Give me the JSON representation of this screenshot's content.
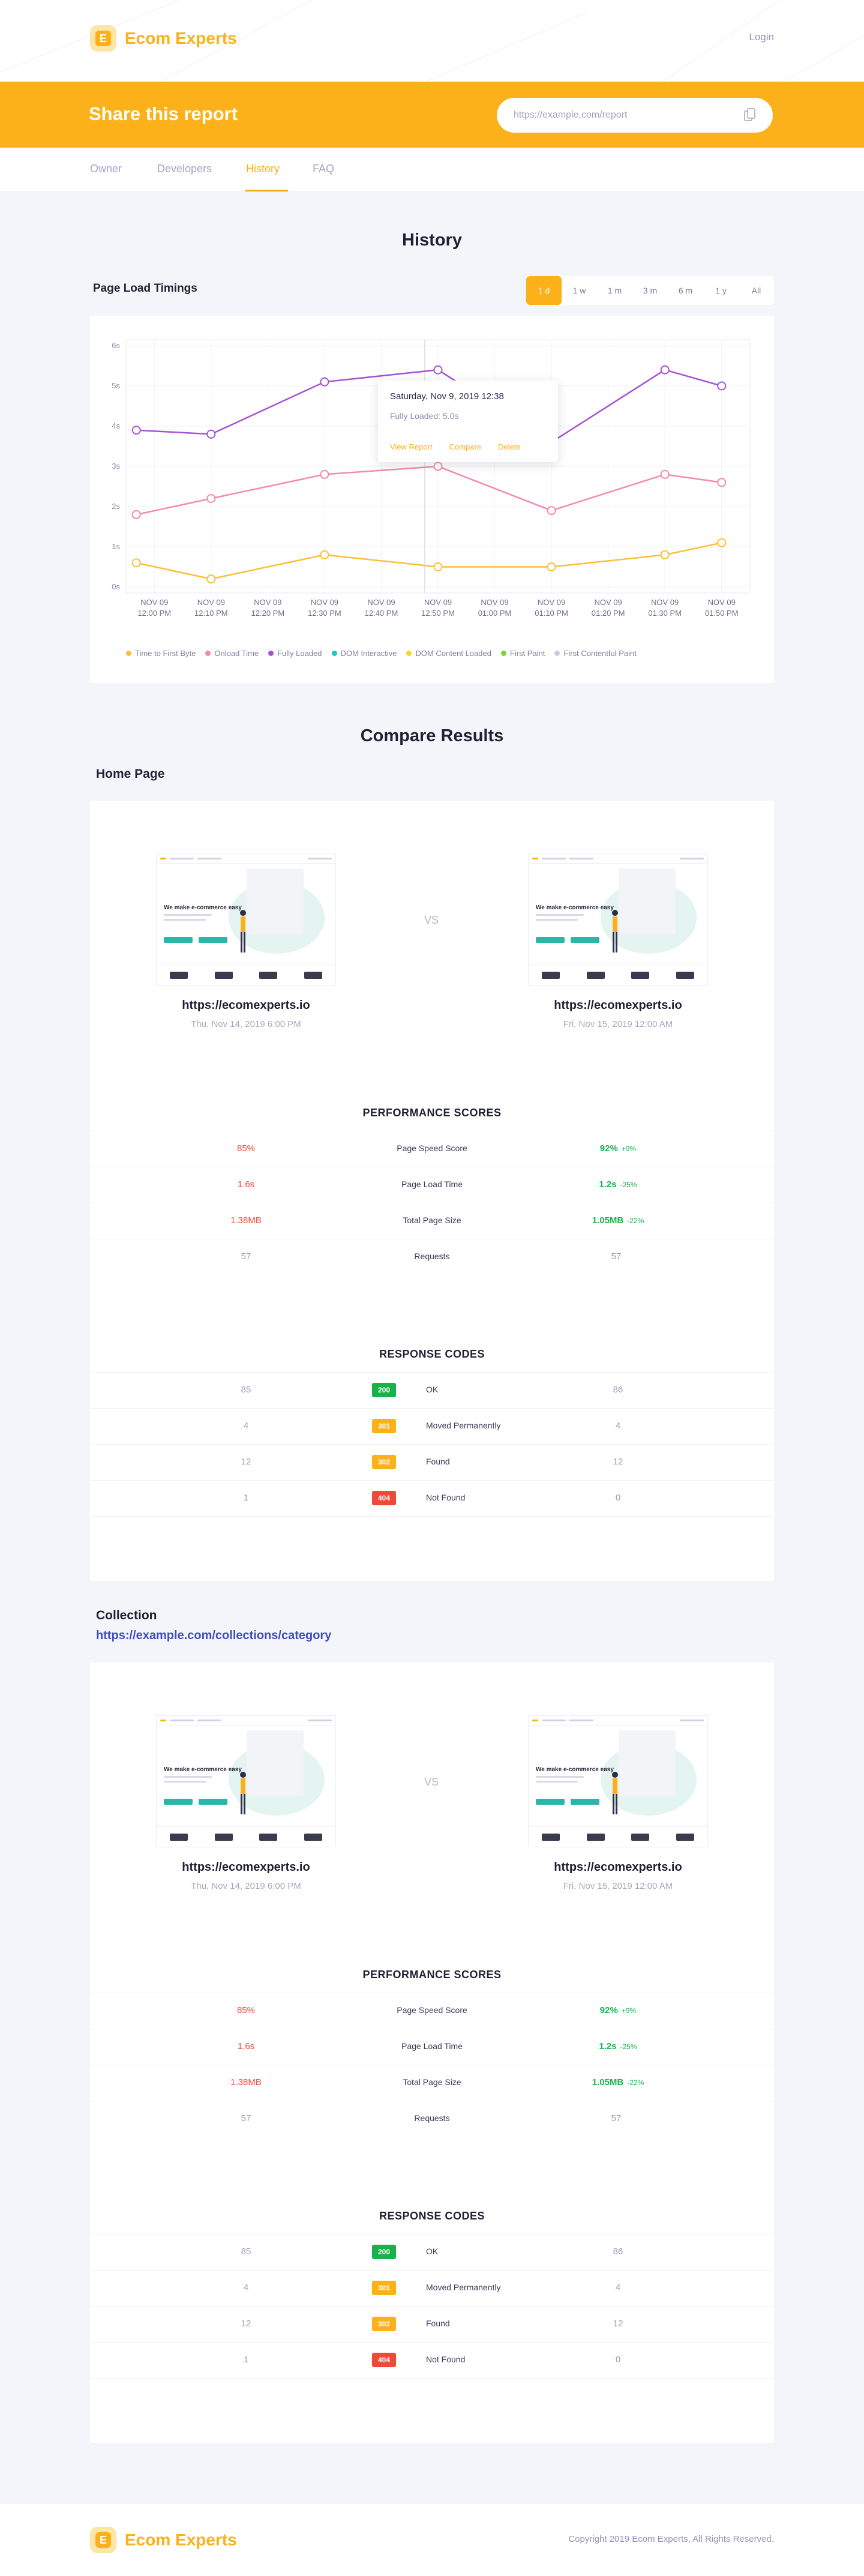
{
  "brand": {
    "name": "Ecom Experts",
    "accent": "#fcb11a"
  },
  "header": {
    "login_label": "Login"
  },
  "share": {
    "title": "Share this report",
    "url_value": "https://example.com/report"
  },
  "tabs": [
    {
      "label": "Owner"
    },
    {
      "label": "Developers"
    },
    {
      "label": "History"
    },
    {
      "label": "FAQ"
    }
  ],
  "active_tab": "History",
  "history": {
    "title": "History",
    "chart_label": "Page Load Timings",
    "ranges": [
      "1 d",
      "1 w",
      "1 m",
      "3 m",
      "6 m",
      "1 y",
      "All"
    ],
    "active_range": "1 d",
    "tooltip": {
      "title": "Saturday, Nov 9, 2019 12:38",
      "value": "Fully Loaded: 5.0s",
      "actions": [
        "View Report",
        "Compare",
        "Delete"
      ]
    }
  },
  "chart_data": {
    "type": "line",
    "categories": [
      "NOV 09 12:00 PM",
      "NOV 09 12:10 PM",
      "NOV 09 12:20 PM",
      "NOV 09 12:30 PM",
      "NOV 09 12:40 PM",
      "NOV 09 12:50 PM",
      "NOV 09 01:00 PM",
      "NOV 09 01:10 PM",
      "NOV 09 01:20 PM",
      "NOV 09 01:30 PM",
      "NOV 09 01:50 PM"
    ],
    "ylim": [
      0,
      6
    ],
    "yticks": [
      "0s",
      "1s",
      "2s",
      "3s",
      "4s",
      "5s",
      "6s"
    ],
    "series": [
      {
        "name": "Time to First Byte",
        "color": "#fcc032",
        "x_index": [
          0,
          1,
          3,
          5,
          7,
          9,
          10
        ],
        "values": [
          0.6,
          0.2,
          0.8,
          0.5,
          0.5,
          0.8,
          1.1
        ]
      },
      {
        "name": "Onload Time",
        "color": "#f58aa8",
        "x_index": [
          0,
          1,
          3,
          5,
          7,
          9,
          10
        ],
        "values": [
          1.8,
          2.2,
          2.8,
          3.0,
          1.9,
          2.8,
          2.6
        ]
      },
      {
        "name": "Fully Loaded",
        "color": "#a651d3",
        "x_index": [
          0,
          1,
          3,
          5,
          7,
          9,
          10
        ],
        "values": [
          3.9,
          3.8,
          5.1,
          5.4,
          3.6,
          5.4,
          5.0
        ]
      },
      {
        "name": "DOM Interactive",
        "color": "#23c4c6",
        "x_index": [],
        "values": []
      },
      {
        "name": "DOM Content Loaded",
        "color": "#f7d627",
        "x_index": [],
        "values": []
      },
      {
        "name": "First Paint",
        "color": "#7ed33b",
        "x_index": [],
        "values": []
      },
      {
        "name": "First Contentful Paint",
        "color": "#c9cbd9",
        "x_index": [],
        "values": []
      }
    ],
    "grid": true,
    "legend_position": "bottom"
  },
  "compare": {
    "title": "Compare Results",
    "sections": [
      {
        "heading": "Home Page",
        "link": "",
        "vs": "VS",
        "left": {
          "url": "https://ecomexperts.io",
          "date": "Thu, Nov 14, 2019 6:00 PM"
        },
        "right": {
          "url": "https://ecomexperts.io",
          "date": "Fri, Nov 15, 2019 12:00 AM"
        },
        "thumb_headline": "We make e-commerce easy",
        "perf_title": "PERFORMANCE SCORES",
        "perf": [
          {
            "label": "Page Speed Score",
            "left": "85%",
            "right": "92%",
            "delta": "+9%"
          },
          {
            "label": "Page Load Time",
            "left": "1.6s",
            "right": "1.2s",
            "delta": "-25%"
          },
          {
            "label": "Total Page Size",
            "left": "1.38MB",
            "right": "1.05MB",
            "delta": "-22%"
          },
          {
            "label": "Requests",
            "left": "57",
            "right": "57",
            "delta": ""
          }
        ],
        "codes_title": "RESPONSE CODES",
        "codes": [
          {
            "code": "200",
            "label": "OK",
            "left": "85",
            "right": "86",
            "color": "#18b24a"
          },
          {
            "code": "301",
            "label": "Moved Permanently",
            "left": "4",
            "right": "4",
            "color": "#fcb11a"
          },
          {
            "code": "302",
            "label": "Found",
            "left": "12",
            "right": "12",
            "color": "#fcb11a"
          },
          {
            "code": "404",
            "label": "Not Found",
            "left": "1",
            "right": "0",
            "color": "#f0493a"
          }
        ]
      },
      {
        "heading": "Collection",
        "link": "https://example.com/collections/category",
        "vs": "VS",
        "left": {
          "url": "https://ecomexperts.io",
          "date": "Thu, Nov 14, 2019 6:00 PM"
        },
        "right": {
          "url": "https://ecomexperts.io",
          "date": "Fri, Nov 15, 2019 12:00 AM"
        },
        "thumb_headline": "We make e-commerce easy",
        "perf_title": "PERFORMANCE SCORES",
        "perf": [
          {
            "label": "Page Speed Score",
            "left": "85%",
            "right": "92%",
            "delta": "+9%"
          },
          {
            "label": "Page Load Time",
            "left": "1.6s",
            "right": "1.2s",
            "delta": "-25%"
          },
          {
            "label": "Total Page Size",
            "left": "1.38MB",
            "right": "1.05MB",
            "delta": "-22%"
          },
          {
            "label": "Requests",
            "left": "57",
            "right": "57",
            "delta": ""
          }
        ],
        "codes_title": "RESPONSE CODES",
        "codes": [
          {
            "code": "200",
            "label": "OK",
            "left": "85",
            "right": "86",
            "color": "#18b24a"
          },
          {
            "code": "301",
            "label": "Moved Permanently",
            "left": "4",
            "right": "4",
            "color": "#fcb11a"
          },
          {
            "code": "302",
            "label": "Found",
            "left": "12",
            "right": "12",
            "color": "#fcb11a"
          },
          {
            "code": "404",
            "label": "Not Found",
            "left": "1",
            "right": "0",
            "color": "#f0493a"
          }
        ]
      }
    ]
  },
  "footer": {
    "copyright": "Copyright 2019 Ecom Experts, All Rights Reserved."
  }
}
